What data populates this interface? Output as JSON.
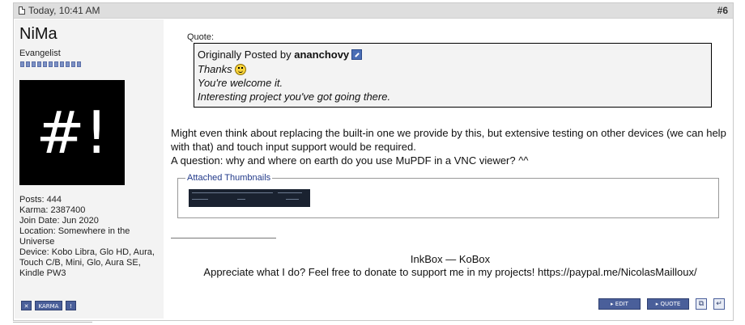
{
  "post": {
    "date": "Today, 10:41 AM",
    "number": "#6"
  },
  "user": {
    "name": "NiMa",
    "title": "Evangelist",
    "reputation_pips": 11,
    "avatar_text": "#!",
    "stats": [
      "Posts: 444",
      "Karma: 2387400",
      "Join Date: Jun 2020",
      "Location: Somewhere in the Universe",
      "Device: Kobo Libra, Glo HD, Aura, Touch C/B, Mini, Glo, Aura SE, Kindle PW3"
    ],
    "buttons": [
      "",
      "KARMA",
      ""
    ]
  },
  "quote": {
    "label": "Quote:",
    "posted_by_prefix": "Originally Posted by",
    "author": "ananchovy",
    "lines": [
      "Thanks",
      "You're welcome it.",
      "Interesting project you've got going there."
    ]
  },
  "body": {
    "paragraph1": "Might even think about replacing the built-in one we provide by this, but extensive testing on other devices (we can help with that) and touch input support would be required.",
    "paragraph2": "A question: why and where on earth do you use MuPDF in a VNC viewer? ^^"
  },
  "attachments": {
    "legend": "Attached Thumbnails"
  },
  "signature": {
    "line1": "InkBox — KoBox",
    "line2": "Appreciate what I do? Feel free to donate to support me in my projects! https://paypal.me/NicolasMailloux/"
  },
  "post_buttons": {
    "edit": "EDIT",
    "quote": "QUOTE"
  }
}
